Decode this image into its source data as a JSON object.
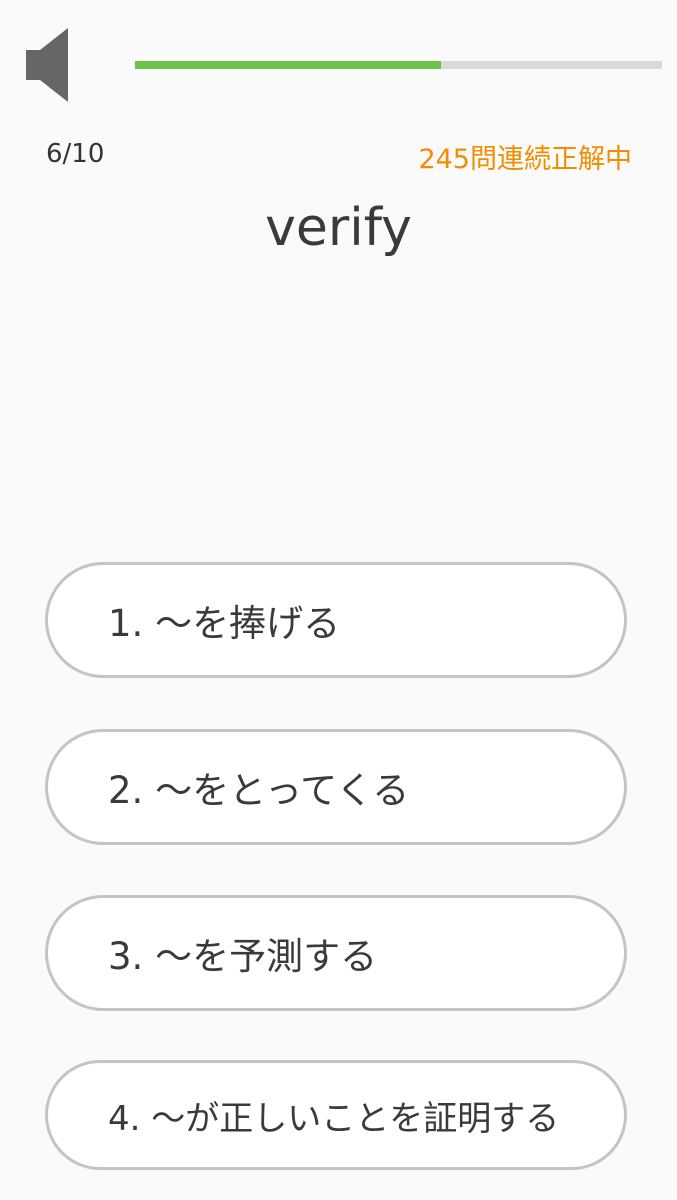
{
  "header": {
    "speaker_icon": "speaker-icon",
    "progress": {
      "current": 6,
      "total": 10,
      "fill_fraction": 0.58,
      "fill_color": "#6cc24a",
      "track_color": "#d9d9d9"
    }
  },
  "quiz": {
    "counter": "6/10",
    "streak": "245問連続正解中",
    "streak_color": "#f28c00",
    "word": "verify"
  },
  "choices": [
    {
      "label": "1. 〜を捧げる"
    },
    {
      "label": "2. 〜をとってくる"
    },
    {
      "label": "3. 〜を予測する"
    },
    {
      "label": "4. 〜が正しいことを証明する"
    }
  ]
}
